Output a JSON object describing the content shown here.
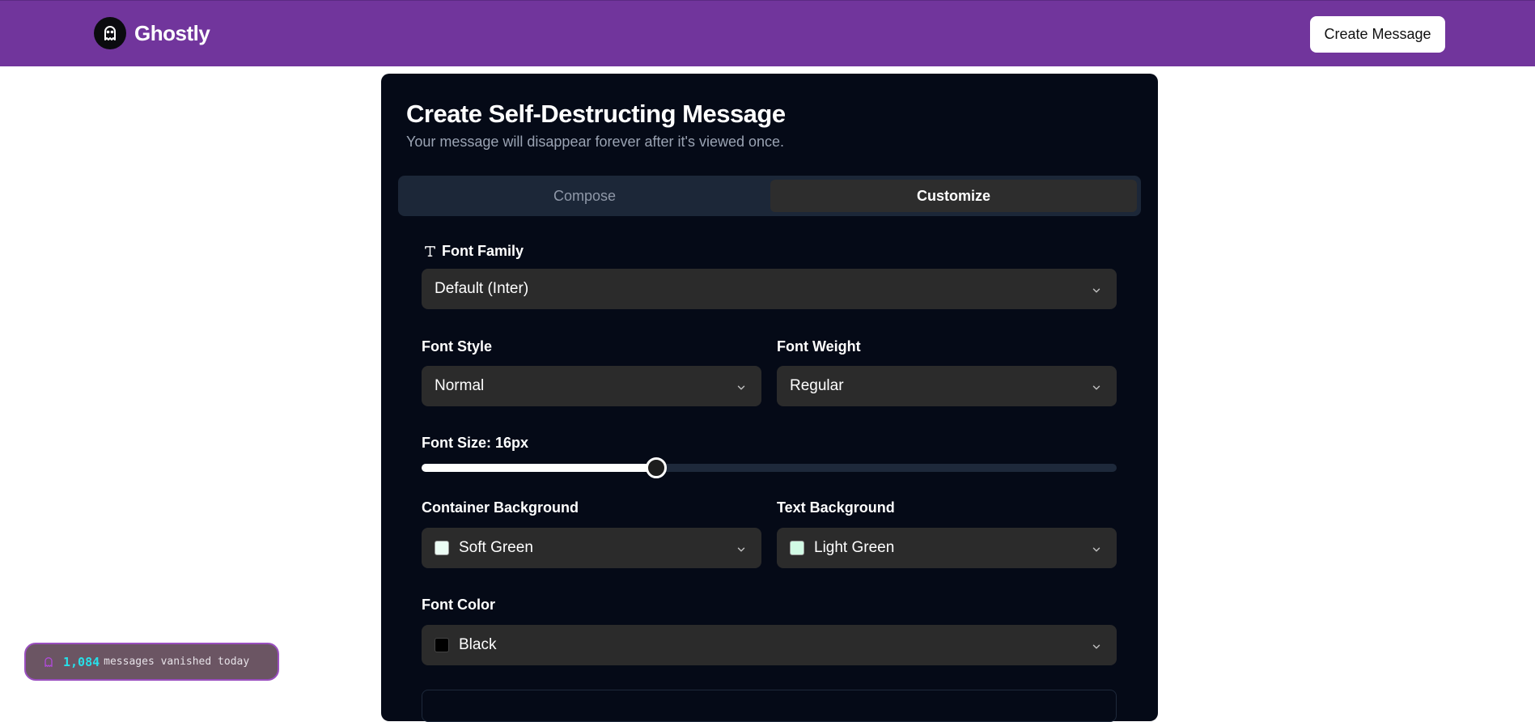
{
  "navbar": {
    "brand_name": "Ghostly",
    "create_button_label": "Create Message",
    "background_color": "#71359c"
  },
  "card": {
    "title": "Create Self-Destructing Message",
    "subtitle": "Your message will disappear forever after it's viewed once.",
    "tabs": [
      {
        "label": "Compose",
        "active": false
      },
      {
        "label": "Customize",
        "active": true
      }
    ]
  },
  "form": {
    "font_family": {
      "label": "Font Family",
      "value": "Default (Inter)",
      "icon": "type-icon"
    },
    "font_style": {
      "label": "Font Style",
      "value": "Normal"
    },
    "font_weight": {
      "label": "Font Weight",
      "value": "Regular"
    },
    "font_size": {
      "label": "Font Size: 16px",
      "value": 16,
      "fraction": 0.338
    },
    "container_background": {
      "label": "Container Background",
      "value": "Soft Green",
      "swatch_color": "#ecfdf5"
    },
    "text_background": {
      "label": "Text Background",
      "value": "Light Green",
      "swatch_color": "#d1fae5"
    },
    "font_color": {
      "label": "Font Color",
      "value": "Black",
      "swatch_color": "#000000"
    }
  },
  "toast": {
    "count": "1,084",
    "text": "messages vanished today",
    "icon": "ghost-icon"
  }
}
